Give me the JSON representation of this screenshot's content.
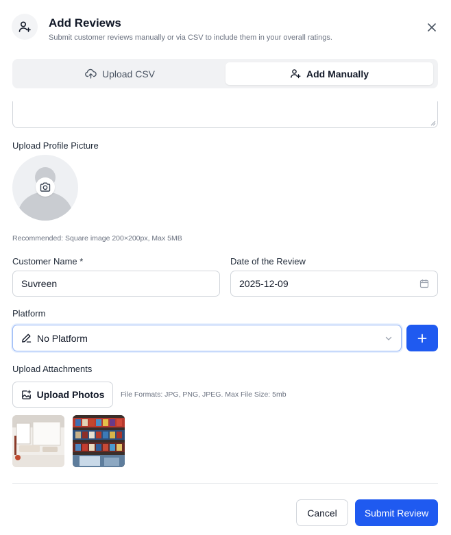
{
  "header": {
    "title": "Add Reviews",
    "subtitle": "Submit customer reviews manually or via CSV to include them in your overall ratings.",
    "icon": "user-plus-icon",
    "close_icon": "close-icon"
  },
  "tabs": [
    {
      "label": "Upload CSV",
      "icon": "cloud-upload-icon",
      "active": false
    },
    {
      "label": "Add Manually",
      "icon": "user-plus-icon",
      "active": true
    }
  ],
  "profile": {
    "label": "Upload Profile Picture",
    "hint": "Recommended: Square image 200×200px, Max 5MB",
    "icon": "camera-icon"
  },
  "customer_name": {
    "label": "Customer Name *",
    "value": "Suvreen"
  },
  "review_date": {
    "label": "Date of the Review",
    "value": "2025-12-09",
    "icon": "calendar-icon"
  },
  "platform": {
    "label": "Platform",
    "selected": "No Platform",
    "icon": "pen-icon",
    "add_icon": "plus-icon"
  },
  "attachments": {
    "label": "Upload Attachments",
    "button_label": "Upload Photos",
    "button_icon": "image-plus-icon",
    "hint": "File Formats: JPG, PNG, JPEG. Max File Size: 5mb"
  },
  "footer": {
    "cancel_label": "Cancel",
    "submit_label": "Submit Review"
  },
  "colors": {
    "primary": "#1f5af0",
    "focus_border": "#93b4f5",
    "muted_text": "#6b7280",
    "border": "#d1d5db"
  }
}
